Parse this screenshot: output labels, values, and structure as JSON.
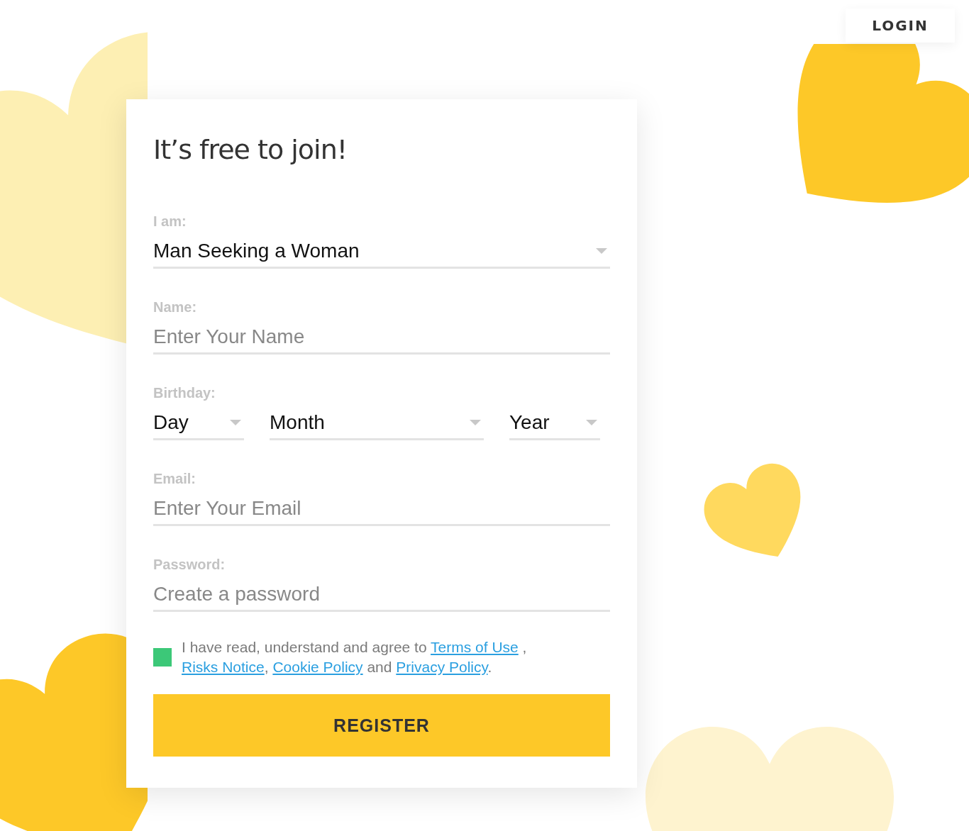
{
  "header": {
    "login_button": "LOGIN"
  },
  "form": {
    "title": "It’s free to join!",
    "fields": [
      {
        "kind": "select",
        "label": "I am:",
        "value": "Man Seeking a Woman"
      },
      {
        "kind": "input",
        "label": "Name:",
        "placeholder": "Enter Your Name"
      },
      {
        "kind": "date",
        "label": "Birthday:",
        "parts": [
          {
            "value": "Day"
          },
          {
            "value": "Month"
          },
          {
            "value": "Year"
          }
        ]
      },
      {
        "kind": "input",
        "label": "Email:",
        "placeholder": "Enter Your Email"
      },
      {
        "kind": "input",
        "label": "Password:",
        "placeholder": "Create a password"
      }
    ],
    "agreement": {
      "checked": true,
      "parts": [
        {
          "kind": "text",
          "text": "I have read, understand and agree to "
        },
        {
          "kind": "link",
          "text": "Terms of Use"
        },
        {
          "kind": "text",
          "text": " , "
        },
        {
          "kind": "link",
          "text": "Risks Notice"
        },
        {
          "kind": "text",
          "text": ", "
        },
        {
          "kind": "link",
          "text": "Cookie Policy"
        },
        {
          "kind": "text",
          "text": " and "
        },
        {
          "kind": "link",
          "text": "Privacy Policy"
        },
        {
          "kind": "text",
          "text": "."
        }
      ]
    },
    "register_button": "REGISTER"
  }
}
